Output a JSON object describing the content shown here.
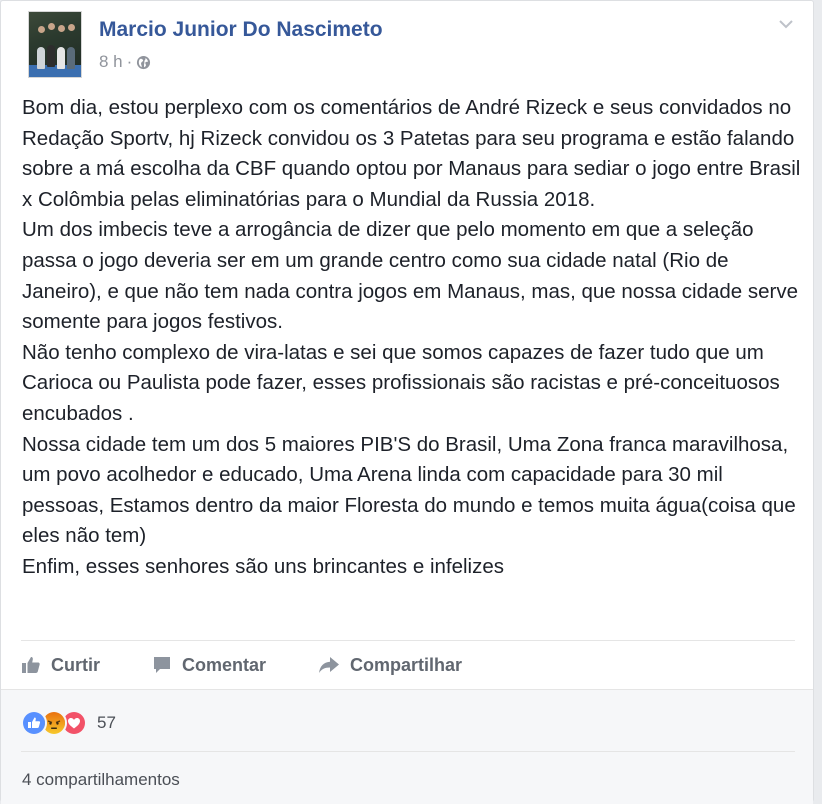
{
  "post": {
    "author": "Marcio Junior Do Nascimeto",
    "time": "8 h",
    "separator": "·",
    "privacy_icon": "globe-icon",
    "paragraphs": [
      "Bom dia, estou perplexo com os comentários de André Rizeck e seus convidados no Redação Sportv, hj Rizeck convidou os 3 Patetas para seu programa e estão falando sobre a má escolha da CBF quando optou por Manaus para sediar o jogo entre Brasil x Colômbia pelas eliminatórias para o Mundial da Russia 2018.",
      "Um dos imbecis teve a arrogância de dizer que pelo momento em que a seleção passa o jogo deveria ser em um grande centro como sua cidade natal (Rio de Janeiro), e que não tem nada contra jogos em Manaus, mas, que nossa cidade serve somente para jogos festivos.",
      "Não tenho complexo de vira-latas e sei que somos capazes de fazer tudo que um Carioca ou Paulista pode fazer, esses profissionais são racistas e pré-conceituosos encubados .",
      "Nossa cidade tem um dos 5 maiores PIB'S do Brasil, Uma Zona franca maravilhosa, um povo acolhedor e educado, Uma Arena linda com capacidade para 30 mil pessoas, Estamos dentro da maior Floresta do mundo e temos muita água(coisa que eles não tem)",
      "Enfim, esses senhores são uns brincantes e infelizes"
    ]
  },
  "actions": {
    "like": "Curtir",
    "comment": "Comentar",
    "share": "Compartilhar"
  },
  "reactions": {
    "types": [
      "like-reaction-icon",
      "angry-reaction-icon",
      "love-reaction-icon"
    ],
    "count": "57"
  },
  "shares": {
    "label": "4 compartilhamentos"
  },
  "colors": {
    "author": "#365899",
    "like_blue": "#5890ff",
    "angry_orange": "#f7b125",
    "love_red": "#f25268"
  }
}
